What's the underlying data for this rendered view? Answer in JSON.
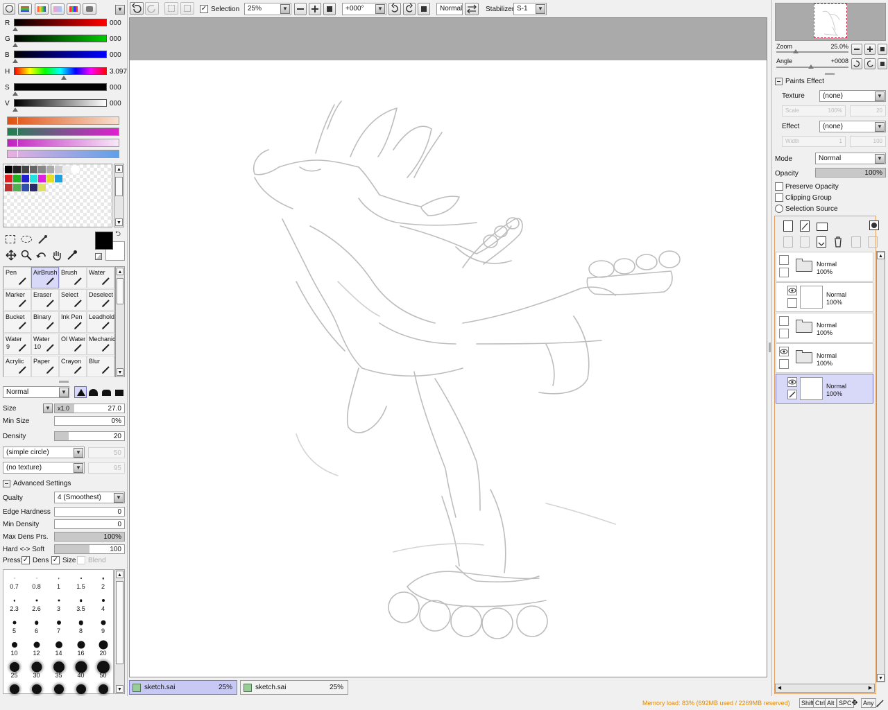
{
  "topbar": {
    "selection_label": "Selection",
    "zoom_value": "25%",
    "angle_value": "+000°",
    "blend_mode": "Normal",
    "stabilizer_label": "Stabilizer",
    "stabilizer_value": "S-1"
  },
  "color_sliders": [
    {
      "label": "R",
      "value": "000",
      "gradient": "linear-gradient(to right,#000,#f00)"
    },
    {
      "label": "G",
      "value": "000",
      "gradient": "linear-gradient(to right,#000,#0c0)"
    },
    {
      "label": "B",
      "value": "000",
      "gradient": "linear-gradient(to right,#000,#00f)"
    },
    {
      "label": "H",
      "value": "3.097",
      "gradient": "linear-gradient(to right,#f00,#ff0,#0f0,#0ff,#00f,#f0f,#f00)"
    },
    {
      "label": "S",
      "value": "000",
      "gradient": "linear-gradient(to right,#000,#000)"
    },
    {
      "label": "V",
      "value": "000",
      "gradient": "linear-gradient(to right,#000,#fff)"
    }
  ],
  "tools": [
    {
      "name": "Pen"
    },
    {
      "name": "AirBrush",
      "active": true
    },
    {
      "name": "Brush"
    },
    {
      "name": "Water"
    },
    {
      "name": "Marker"
    },
    {
      "name": "Eraser"
    },
    {
      "name": "Select"
    },
    {
      "name": "Deselect"
    },
    {
      "name": "Bucket"
    },
    {
      "name": "Binary"
    },
    {
      "name": "Ink Pen"
    },
    {
      "name": "Leadhold"
    },
    {
      "name": "Water",
      "num": "9"
    },
    {
      "name": "Water",
      "num": "10"
    },
    {
      "name": "Ol Water"
    },
    {
      "name": "Mechanic"
    },
    {
      "name": "Acrylic"
    },
    {
      "name": "Paper"
    },
    {
      "name": "Crayon"
    },
    {
      "name": "Blur"
    }
  ],
  "brush": {
    "blend_mode": "Normal",
    "size_label": "Size",
    "size_mult": "x1.0",
    "size_value": "27.0",
    "min_size_label": "Min Size",
    "min_size_value": "0%",
    "density_label": "Density",
    "density_value": "20",
    "shape": "(simple circle)",
    "shape_value": "50",
    "texture": "(no texture)",
    "texture_value": "95",
    "advanced_label": "Advanced Settings",
    "quality_label": "Qualty",
    "quality_value": "4 (Smoothest)",
    "edge_label": "Edge Hardness",
    "edge_value": "0",
    "min_density_label": "Min Density",
    "min_density_value": "0",
    "max_dens_label": "Max Dens Prs.",
    "max_dens_value": "100%",
    "hard_soft_label": "Hard <-> Soft",
    "hard_soft_value": "100",
    "press_label": "Press:",
    "press_dens": "Dens",
    "press_size": "Size",
    "press_blend": "Blend"
  },
  "brush_sizes": [
    "0.7",
    "0.8",
    "1",
    "1.5",
    "2",
    "2.3",
    "2.6",
    "3",
    "3.5",
    "4",
    "5",
    "6",
    "7",
    "8",
    "9",
    "10",
    "12",
    "14",
    "16",
    "20",
    "25",
    "30",
    "35",
    "40",
    "50",
    "",
    "",
    "",
    "",
    ""
  ],
  "navigator": {
    "zoom_label": "Zoom",
    "zoom_value": "25.0%",
    "angle_label": "Angle",
    "angle_value": "+0008"
  },
  "paints_effect": {
    "title": "Paints Effect",
    "texture_label": "Texture",
    "texture_value": "(none)",
    "scale_label": "Scale",
    "scale_value": "100%",
    "scale_num": "20",
    "effect_label": "Effect",
    "effect_value": "(none)",
    "width_label": "Width",
    "width_value": "1",
    "width_num": "100"
  },
  "layer_props": {
    "mode_label": "Mode",
    "mode_value": "Normal",
    "opacity_label": "Opacity",
    "opacity_value": "100%",
    "preserve_opacity": "Preserve Opacity",
    "clipping_group": "Clipping Group",
    "selection_source": "Selection Source"
  },
  "layers": [
    {
      "mode": "Normal",
      "opacity": "100%",
      "type": "folder",
      "indent": false
    },
    {
      "mode": "Normal",
      "opacity": "100%",
      "type": "layer",
      "indent": true
    },
    {
      "mode": "Normal",
      "opacity": "100%",
      "type": "folder",
      "indent": false
    },
    {
      "mode": "Normal",
      "opacity": "100%",
      "type": "folder",
      "indent": false
    },
    {
      "mode": "Normal",
      "opacity": "100%",
      "type": "layer",
      "indent": true,
      "selected": true
    }
  ],
  "tabs": [
    {
      "name": "sketch.sai",
      "zoom": "25%",
      "active": true
    },
    {
      "name": "sketch.sai",
      "zoom": "25%",
      "active": false
    }
  ],
  "status": {
    "memory": "Memory load: 83% (692MB used / 2269MB reserved)",
    "keys": [
      "Shift",
      "Ctrl",
      "Alt",
      "SPC",
      "Any"
    ]
  },
  "colors": {
    "accent": "#c8c8f4",
    "status_orange": "#e08a00"
  }
}
